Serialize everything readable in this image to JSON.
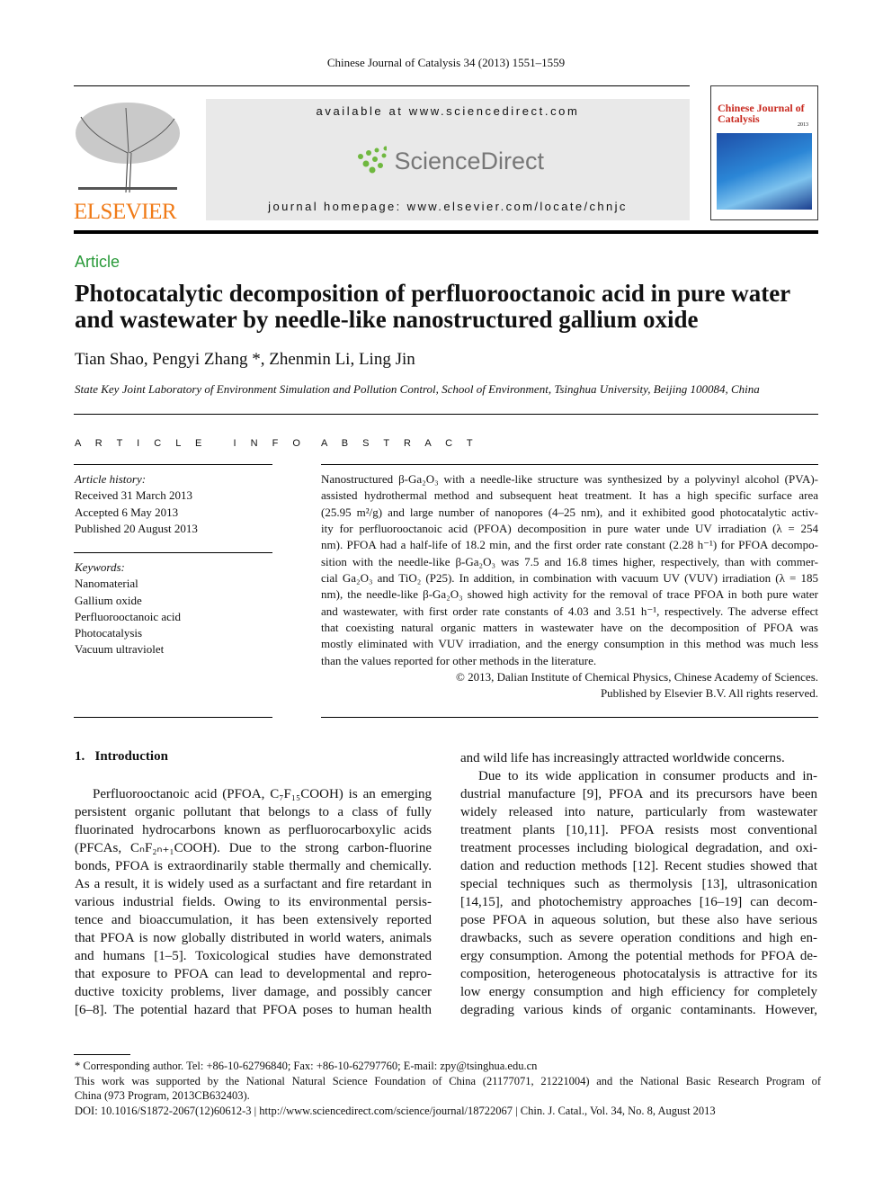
{
  "header": {
    "citation": "Chinese Journal of Catalysis 34 (2013) 1551–1559",
    "available": "available at www.sciencedirect.com",
    "sciencedirect": "ScienceDirect",
    "homepage": "journal homepage: www.elsevier.com/locate/chnjc",
    "publisher": "ELSEVIER",
    "cover_title": "Chinese Journal of Catalysis",
    "cover_year": "2013"
  },
  "article_type": "Article",
  "title": "Photocatalytic decomposition of perfluorooctanoic acid in pure water and wastewater by needle-like nanostructured gallium oxide",
  "authors": "Tian Shao, Pengyi Zhang *, Zhenmin Li, Ling Jin",
  "affiliation": "State Key Joint Laboratory of Environment Simulation and Pollution Control, School of Environment, Tsinghua University, Beijing 100084, China",
  "article_info": {
    "heading": "A R T I C L E   I N F O",
    "history_label": "Article history:",
    "history": [
      "Received 31 March 2013",
      "Accepted 6 May 2013",
      "Published 20 August 2013"
    ],
    "keywords_label": "Keywords:",
    "keywords": [
      "Nanomaterial",
      "Gallium oxide",
      "Perfluorooctanoic acid",
      "Photocatalysis",
      "Vacuum ultraviolet"
    ]
  },
  "abstract": {
    "heading": "A B S T R A C T",
    "lines": [
      "Nanostructured β-Ga₂O₃ with a needle-like structure was synthesized by a polyvinyl alcohol (PVA)-",
      "assisted hydrothermal method and subsequent heat treatment. It has a high specific surface area",
      "(25.95 m²/g) and large number of nanopores (4–25 nm), and it exhibited good photocatalytic activ-",
      "ity for perfluorooctanoic acid (PFOA) decomposition in pure water unde UV irradiation (λ = 254",
      "nm). PFOA had a half-life of 18.2 min, and the first order rate constant (2.28 h⁻¹) for PFOA decompo-",
      "sition with the needle-like β-Ga₂O₃ was 7.5 and 16.8 times higher, respectively, than with commer-",
      "cial Ga₂O₃ and TiO₂ (P25). In addition, in combination with vacuum UV (VUV) irradiation (λ = 185",
      "nm), the needle-like β-Ga₂O₃ showed high activity for the removal of trace PFOA in both pure water",
      "and wastewater, with first order rate constants of 4.03 and 3.51 h⁻¹, respectively. The adverse effect",
      "that coexisting natural organic matters in wastewater have on the decomposition of PFOA was",
      "mostly eliminated with VUV irradiation, and the energy consumption in this method was much less",
      "than the values reported for other methods in the literature."
    ],
    "copyright": [
      "© 2013, Dalian Institute of Chemical Physics, Chinese Academy of Sciences.",
      "Published by Elsevier B.V. All rights reserved."
    ]
  },
  "intro": {
    "heading": "1.   Introduction",
    "left_lines": [
      "Perfluorooctanoic acid (PFOA, C₇F₁₅COOH) is an emerging",
      "persistent organic pollutant that belongs to a class of fully",
      "fluorinated hydrocarbons known as perfluorocarboxylic acids",
      "(PFCAs, CₙF₂ₙ₊₁COOH). Due to the strong carbon-fluorine",
      "bonds, PFOA is extraordinarily stable thermally and chemically.",
      "As a result, it is widely used as a surfactant and fire retardant in",
      "various industrial fields. Owing to its environmental persis-",
      "tence and bioaccumulation, it has been extensively reported",
      "that PFOA is now globally distributed in world waters, animals",
      "and humans [1–5]. Toxicological studies have demonstrated",
      "that exposure to PFOA can lead to developmental and repro-",
      "ductive toxicity problems, liver damage, and possibly cancer",
      "[6–8]. The potential hazard that PFOA poses to human health"
    ],
    "right_p1": "and wild life has increasingly attracted worldwide concerns.",
    "right_lines": [
      "Due to its wide application in consumer products and in-",
      "dustrial manufacture [9], PFOA and its precursors have been",
      "widely released into nature, particularly from wastewater",
      "treatment plants [10,11]. PFOA resists most conventional",
      "treatment processes including biological degradation, and oxi-",
      "dation and reduction methods [12]. Recent studies showed that",
      "special techniques such as thermolysis [13], ultrasonication",
      "[14,15], and photochemistry approaches [16–19] can decom-",
      "pose PFOA in aqueous solution, but these also have serious",
      "drawbacks, such as severe operation conditions and high en-",
      "ergy consumption. Among the potential methods for PFOA de-",
      "composition, heterogeneous photocatalysis is attractive for its",
      "low energy consumption and high efficiency for completely",
      "degrading various kinds of organic contaminants. However,"
    ]
  },
  "footnotes": {
    "corresponding": "* Corresponding author. Tel: +86-10-62796840; Fax: +86-10-62797760; E-mail: zpy@tsinghua.edu.cn",
    "funding1": "This work was supported by the National Natural Science Foundation of China (21177071, 21221004) and the National Basic Research Program of",
    "funding2": "China (973 Program, 2013CB632403).",
    "doi": "DOI: 10.1016/S1872-2067(12)60612-3 | http://www.sciencedirect.com/science/journal/18722067 | Chin. J. Catal., Vol. 34, No. 8, August 2013"
  },
  "colors": {
    "article_green": "#2a9a3a",
    "elsevier_orange": "#f07a16",
    "journal_red": "#c8281e"
  }
}
